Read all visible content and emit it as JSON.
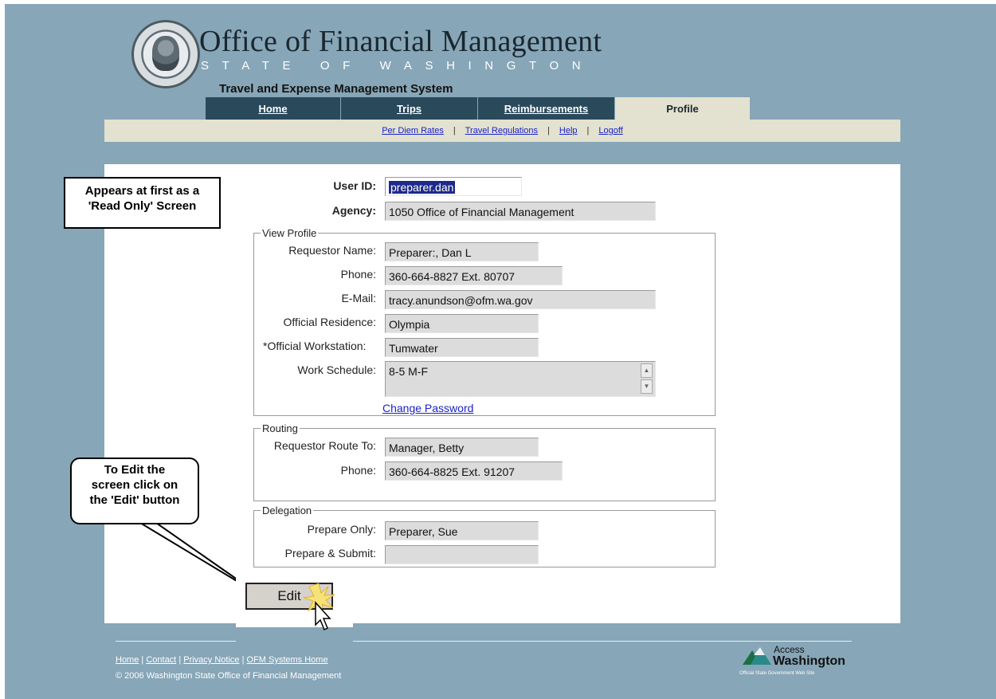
{
  "header": {
    "org_title": "Office of Financial Management",
    "org_subtitle": "STATE OF WASHINGTON",
    "app_title": "Travel and Expense Management System"
  },
  "tabs": [
    {
      "label": "Home",
      "active": false
    },
    {
      "label": "Trips",
      "active": false
    },
    {
      "label": "Reimbursements",
      "active": false
    },
    {
      "label": "Profile",
      "active": true
    }
  ],
  "subnav": {
    "per_diem": "Per Diem Rates",
    "travel_regs": "Travel Regulations",
    "help": "Help",
    "logoff": "Logoff",
    "separator": "|"
  },
  "form": {
    "user_id_label": "User ID:",
    "user_id_value": "preparer.dan",
    "agency_label": "Agency:",
    "agency_value": "1050 Office of Financial Management",
    "view_profile": {
      "legend": "View Profile",
      "requestor_name_label": "Requestor Name:",
      "requestor_name_value": "Preparer:, Dan L",
      "phone_label": "Phone:",
      "phone_value": "360-664-8827 Ext. 80707",
      "email_label": "E-Mail:",
      "email_value": "tracy.anundson@ofm.wa.gov",
      "residence_label": "Official Residence:",
      "residence_value": "Olympia",
      "workstation_label": "*Official Workstation:",
      "workstation_value": "Tumwater",
      "schedule_label": "Work Schedule:",
      "schedule_value": "8-5 M-F",
      "change_password": "Change Password"
    },
    "routing": {
      "legend": "Routing",
      "route_to_label": "Requestor Route To:",
      "route_to_value": "Manager, Betty",
      "phone_label": "Phone:",
      "phone_value": "360-664-8825 Ext. 91207"
    },
    "delegation": {
      "legend": "Delegation",
      "prepare_only_label": "Prepare Only:",
      "prepare_only_value": "Preparer, Sue",
      "prepare_submit_label": "Prepare & Submit:",
      "prepare_submit_value": ""
    },
    "edit_button": "Edit"
  },
  "callouts": {
    "read_only_line1": "Appears at first as a",
    "read_only_line2": "'Read Only' Screen",
    "edit_line1": "To Edit the",
    "edit_line2": "screen click on",
    "edit_line3": "the 'Edit' button"
  },
  "footer": {
    "home": "Home",
    "contact": "Contact",
    "privacy": "Privacy Notice",
    "ofm_systems": "OFM Systems Home",
    "separator": "|",
    "copyright": "© 2006 Washington State Office of Financial Management",
    "aw_line1": "Access",
    "aw_line2": "Washington",
    "aw_tag": "Official State Government Web Site"
  }
}
